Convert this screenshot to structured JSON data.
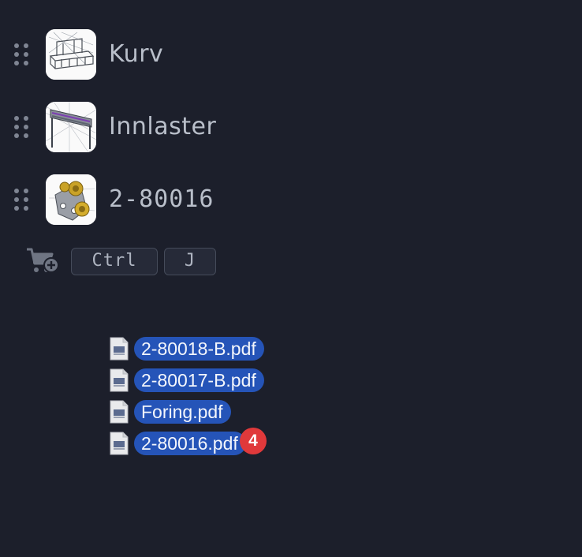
{
  "list": {
    "items": [
      {
        "label": "Kurv",
        "thumb_icon": "basket-drawing-icon"
      },
      {
        "label": "Innlaster",
        "thumb_icon": "loader-drawing-icon"
      },
      {
        "label": "2-80016",
        "thumb_icon": "bracket-wheels-drawing-icon"
      }
    ]
  },
  "shortcut": {
    "icon": "cart-add-icon",
    "keys": [
      "Ctrl",
      "J"
    ]
  },
  "drag": {
    "files": [
      {
        "name": "2-80018-B.pdf"
      },
      {
        "name": "2-80017-B.pdf"
      },
      {
        "name": "Foring.pdf"
      },
      {
        "name": "2-80016.pdf"
      }
    ],
    "count_badge": "4"
  },
  "colors": {
    "background": "#1c1f2b",
    "pill": "#2554b8",
    "badge": "#e0393b"
  }
}
